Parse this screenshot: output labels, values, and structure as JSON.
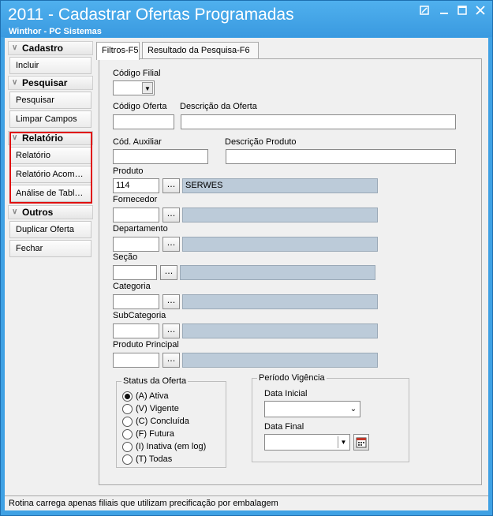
{
  "window": {
    "title": "2011 - Cadastrar Ofertas Programadas",
    "subtitle": "Winthor - PC Sistemas",
    "controls": [
      "restore-icon",
      "minimize-icon",
      "maximize-icon",
      "close-icon"
    ]
  },
  "sidebar": {
    "cadastro": {
      "title": "Cadastro",
      "items": [
        "Incluir"
      ]
    },
    "pesquisar": {
      "title": "Pesquisar",
      "items": [
        "Pesquisar",
        "Limpar Campos"
      ]
    },
    "relatorio": {
      "title": "Relatório",
      "items": [
        "Relatório",
        "Relatório Acom…",
        "Análise de Tabl…"
      ]
    },
    "outros": {
      "title": "Outros",
      "items": [
        "Duplicar Oferta",
        "Fechar"
      ]
    }
  },
  "tabs": [
    {
      "label": "Filtros-F5"
    },
    {
      "label": "Resultado da Pesquisa-F6"
    }
  ],
  "filters": {
    "codigo_filial": {
      "label": "Código Filial",
      "value": ""
    },
    "codigo_oferta": {
      "label": "Código Oferta",
      "value": ""
    },
    "descricao_oferta": {
      "label": "Descrição da Oferta",
      "value": ""
    },
    "cod_auxiliar": {
      "label": "Cód. Auxiliar",
      "value": ""
    },
    "descricao_produto": {
      "label": "Descrição Produto",
      "value": ""
    },
    "produto": {
      "label": "Produto",
      "code": "114",
      "description": "SERWES"
    },
    "fornecedor": {
      "label": "Fornecedor",
      "code": "",
      "description": ""
    },
    "departamento": {
      "label": "Departamento",
      "code": "",
      "description": ""
    },
    "secao": {
      "label": "Seção",
      "code": "",
      "description": ""
    },
    "categoria": {
      "label": "Categoria",
      "code": "",
      "description": ""
    },
    "subcategoria": {
      "label": "SubCategoria",
      "code": "",
      "description": ""
    },
    "produto_principal": {
      "label": "Produto Principal",
      "code": "",
      "description": ""
    },
    "lookup_button": "..."
  },
  "status_oferta": {
    "title": "Status da Oferta",
    "options": [
      {
        "label": "(A) Ativa",
        "selected": true
      },
      {
        "label": "(V) Vigente",
        "selected": false
      },
      {
        "label": "(C) Concluída",
        "selected": false
      },
      {
        "label": "(F) Futura",
        "selected": false
      },
      {
        "label": "(I) Inativa (em log)",
        "selected": false
      },
      {
        "label": "(T) Todas",
        "selected": false
      }
    ]
  },
  "periodo_vigencia": {
    "title": "Período Vigência",
    "data_inicial": {
      "label": "Data Inicial",
      "value": ""
    },
    "data_final": {
      "label": "Data Final",
      "value": ""
    }
  },
  "status_bar": {
    "text": "Rotina carrega apenas filiais que utilizam precificação por embalagem"
  },
  "colors": {
    "titlebar": "#3fa1e4",
    "readonly_field": "#bccbd9",
    "highlight": "#e01010"
  }
}
